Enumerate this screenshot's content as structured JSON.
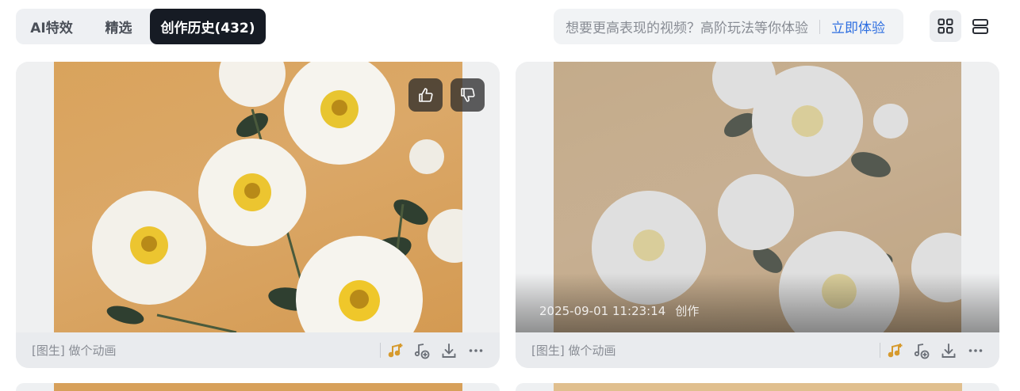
{
  "tabs": [
    {
      "label": "AI特效"
    },
    {
      "label": "精选"
    },
    {
      "label": "创作历史(432)"
    }
  ],
  "promo": {
    "text": "想要更高表现的视频？高阶玩法等你体验",
    "link": "立即体验"
  },
  "view_toggle": {
    "grid_icon": "grid-icon",
    "list_icon": "list-icon",
    "selected": "grid"
  },
  "cards": [
    {
      "caption": "[图生] 做个动画",
      "timestamp": "",
      "action_label": "",
      "rating_up_icon": "thumbs-up-icon",
      "rating_down_icon": "thumbs-down-icon"
    },
    {
      "caption": "[图生] 做个动画",
      "timestamp": "2025-09-01 11:23:14",
      "action_label": "创作"
    }
  ],
  "colors": {
    "active_tab_bg": "#161b24",
    "link": "#2f6fe0",
    "music_icon": "#d69a2d"
  }
}
